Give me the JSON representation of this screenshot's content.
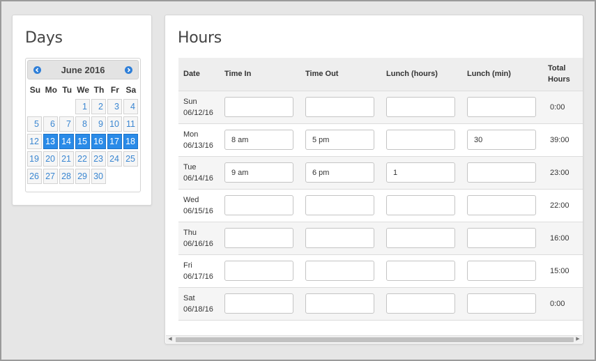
{
  "days": {
    "title": "Days",
    "calendar": {
      "month_label": "June 2016",
      "prev_icon": "chevron-left-circle",
      "next_icon": "chevron-right-circle",
      "weekdays": [
        "Su",
        "Mo",
        "Tu",
        "We",
        "Th",
        "Fr",
        "Sa"
      ],
      "weeks": [
        [
          "",
          "",
          "",
          "1",
          "2",
          "3",
          "4"
        ],
        [
          "5",
          "6",
          "7",
          "8",
          "9",
          "10",
          "11"
        ],
        [
          "12",
          "13",
          "14",
          "15",
          "16",
          "17",
          "18"
        ],
        [
          "19",
          "20",
          "21",
          "22",
          "23",
          "24",
          "25"
        ],
        [
          "26",
          "27",
          "28",
          "29",
          "30",
          "",
          ""
        ]
      ],
      "selected_days": [
        "13",
        "14",
        "15",
        "16",
        "17",
        "18"
      ],
      "accent_color": "#2a8be8"
    }
  },
  "hours": {
    "title": "Hours",
    "headers": {
      "date": "Date",
      "time_in": "Time In",
      "time_out": "Time Out",
      "lunch_hours": "Lunch (hours)",
      "lunch_min": "Lunch (min)",
      "total_line1": "Total",
      "total_line2": "Hours"
    },
    "rows": [
      {
        "day": "Sun",
        "date": "06/12/16",
        "time_in": "",
        "time_out": "",
        "lunch_hours": "",
        "lunch_min": "",
        "total": "0:00"
      },
      {
        "day": "Mon",
        "date": "06/13/16",
        "time_in": "8 am",
        "time_out": "5 pm",
        "lunch_hours": "",
        "lunch_min": "30",
        "total": "39:00"
      },
      {
        "day": "Tue",
        "date": "06/14/16",
        "time_in": "9 am",
        "time_out": "6 pm",
        "lunch_hours": "1",
        "lunch_min": "",
        "total": "23:00"
      },
      {
        "day": "Wed",
        "date": "06/15/16",
        "time_in": "",
        "time_out": "",
        "lunch_hours": "",
        "lunch_min": "",
        "total": "22:00"
      },
      {
        "day": "Thu",
        "date": "06/16/16",
        "time_in": "",
        "time_out": "",
        "lunch_hours": "",
        "lunch_min": "",
        "total": "16:00"
      },
      {
        "day": "Fri",
        "date": "06/17/16",
        "time_in": "",
        "time_out": "",
        "lunch_hours": "",
        "lunch_min": "",
        "total": "15:00"
      },
      {
        "day": "Sat",
        "date": "06/18/16",
        "time_in": "",
        "time_out": "",
        "lunch_hours": "",
        "lunch_min": "",
        "total": "0:00"
      }
    ],
    "scrollbar": {
      "left_icon": "scroll-left-arrow",
      "right_icon": "scroll-right-arrow"
    }
  }
}
